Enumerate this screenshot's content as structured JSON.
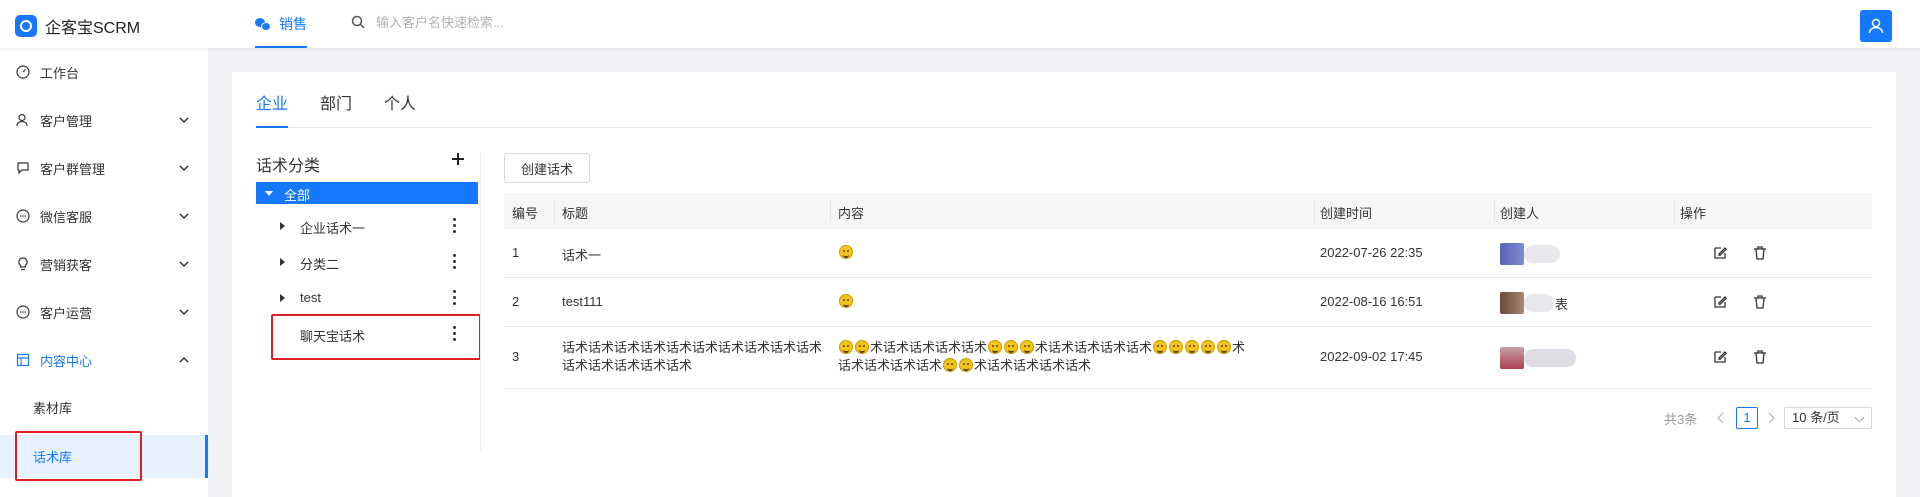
{
  "app": {
    "title": "企客宝SCRM"
  },
  "topnav": {
    "tab_label": "销售",
    "search_placeholder": "输入客户名快速检索..."
  },
  "sidebar": {
    "items": [
      {
        "label": "工作台"
      },
      {
        "label": "客户管理"
      },
      {
        "label": "客户群管理"
      },
      {
        "label": "微信客服"
      },
      {
        "label": "营销获客"
      },
      {
        "label": "客户运营"
      },
      {
        "label": "内容中心"
      }
    ],
    "sub_items": [
      {
        "label": "素材库"
      },
      {
        "label": "话术库"
      }
    ]
  },
  "tabs": [
    {
      "label": "企业"
    },
    {
      "label": "部门"
    },
    {
      "label": "个人"
    }
  ],
  "category": {
    "title": "话术分类",
    "all_label": "全部",
    "items": [
      {
        "label": "企业话术一"
      },
      {
        "label": "分类二"
      },
      {
        "label": "test"
      },
      {
        "label": "聊天宝话术"
      }
    ]
  },
  "create_button": "创建话术",
  "table": {
    "headers": [
      "编号",
      "标题",
      "内容",
      "创建时间",
      "创建人",
      "操作"
    ],
    "rows": [
      {
        "id": "1",
        "title": "话术一",
        "created": "2022-07-26 22:35",
        "creator_suffix": ""
      },
      {
        "id": "2",
        "title": "test111",
        "created": "2022-08-16 16:51",
        "creator_suffix": "表"
      },
      {
        "id": "3",
        "title": "话术话术话术话术话术话术话术话术话术话术话术话术话术话术话术",
        "created": "2022-09-02 17:45",
        "creator_suffix": ""
      }
    ],
    "row3_content": {
      "seg1": "术话术话术话术话术",
      "seg2": "术话术话术话术话术",
      "seg3": "术",
      "seg4": "话术话术话术话术",
      "seg5": "术话术话术话术话术"
    }
  },
  "pagination": {
    "total": "共3条",
    "page": "1",
    "page_size": "10 条/页"
  },
  "colors": {
    "accent": "#1677ff",
    "highlight_box": "#e02020"
  },
  "icons": [
    "dashboard-icon",
    "customer-icon",
    "chat-icon",
    "wechat-service-icon",
    "bulb-icon",
    "operation-icon",
    "content-icon",
    "search-icon",
    "user-icon",
    "plus-icon",
    "more-icon",
    "edit-icon",
    "delete-icon"
  ]
}
